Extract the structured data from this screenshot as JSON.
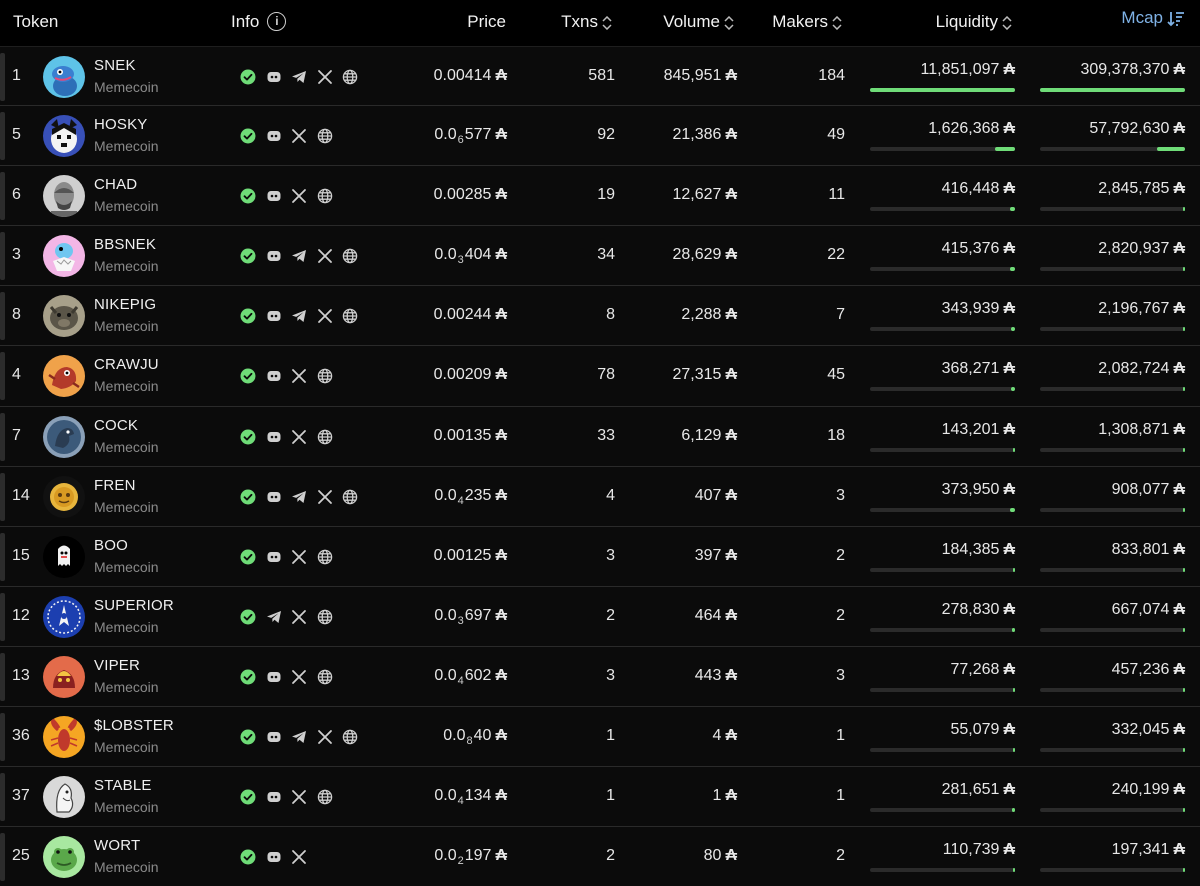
{
  "header": {
    "token": "Token",
    "info": "Info",
    "info_symbol": "i",
    "price": "Price",
    "txns": "Txns",
    "volume": "Volume",
    "makers": "Makers",
    "liquidity": "Liquidity",
    "mcap": "Mcap"
  },
  "colors": {
    "accent_green": "#6fdc78",
    "mcap_header": "#7fb2e6",
    "bar_track": "#2b2b2b"
  },
  "currency_symbol": "₳",
  "rows": [
    {
      "rank": "1",
      "name": "SNEK",
      "category": "Memecoin",
      "icons": [
        "verified-icon",
        "discord-icon",
        "telegram-icon",
        "x-icon",
        "globe-icon"
      ],
      "price_pre": "0.00414",
      "price_sub": "",
      "price_post": "",
      "txns": "581",
      "volume": "845,951",
      "makers": "184",
      "liquidity": "11,851,097",
      "liq_fill": 1.0,
      "mcap": "309,378,370",
      "mcap_fill": 1.0,
      "avatar": "snek"
    },
    {
      "rank": "5",
      "name": "HOSKY",
      "category": "Memecoin",
      "icons": [
        "verified-icon",
        "discord-icon",
        "x-icon",
        "globe-icon"
      ],
      "price_pre": "0.0",
      "price_sub": "6",
      "price_post": "577",
      "txns": "92",
      "volume": "21,386",
      "makers": "49",
      "liquidity": "1,626,368",
      "liq_fill": 0.14,
      "mcap": "57,792,630",
      "mcap_fill": 0.19,
      "avatar": "hosky"
    },
    {
      "rank": "6",
      "name": "CHAD",
      "category": "Memecoin",
      "icons": [
        "verified-icon",
        "discord-icon",
        "x-icon",
        "globe-icon"
      ],
      "price_pre": "0.00285",
      "price_sub": "",
      "price_post": "",
      "txns": "19",
      "volume": "12,627",
      "makers": "11",
      "liquidity": "416,448",
      "liq_fill": 0.035,
      "mcap": "2,845,785",
      "mcap_fill": 0.012,
      "avatar": "chad"
    },
    {
      "rank": "3",
      "name": "BBSNEK",
      "category": "Memecoin",
      "icons": [
        "verified-icon",
        "discord-icon",
        "telegram-icon",
        "x-icon",
        "globe-icon"
      ],
      "price_pre": "0.0",
      "price_sub": "3",
      "price_post": "404",
      "txns": "34",
      "volume": "28,629",
      "makers": "22",
      "liquidity": "415,376",
      "liq_fill": 0.035,
      "mcap": "2,820,937",
      "mcap_fill": 0.012,
      "avatar": "bbsnek"
    },
    {
      "rank": "8",
      "name": "NIKEPIG",
      "category": "Memecoin",
      "icons": [
        "verified-icon",
        "discord-icon",
        "telegram-icon",
        "x-icon",
        "globe-icon"
      ],
      "price_pre": "0.00244",
      "price_sub": "",
      "price_post": "",
      "txns": "8",
      "volume": "2,288",
      "makers": "7",
      "liquidity": "343,939",
      "liq_fill": 0.029,
      "mcap": "2,196,767",
      "mcap_fill": 0.01,
      "avatar": "nikepig"
    },
    {
      "rank": "4",
      "name": "CRAWJU",
      "category": "Memecoin",
      "icons": [
        "verified-icon",
        "discord-icon",
        "x-icon",
        "globe-icon"
      ],
      "price_pre": "0.00209",
      "price_sub": "",
      "price_post": "",
      "txns": "78",
      "volume": "27,315",
      "makers": "45",
      "liquidity": "368,271",
      "liq_fill": 0.031,
      "mcap": "2,082,724",
      "mcap_fill": 0.009,
      "avatar": "crawju"
    },
    {
      "rank": "7",
      "name": "COCK",
      "category": "Memecoin",
      "icons": [
        "verified-icon",
        "discord-icon",
        "x-icon",
        "globe-icon"
      ],
      "price_pre": "0.00135",
      "price_sub": "",
      "price_post": "",
      "txns": "33",
      "volume": "6,129",
      "makers": "18",
      "liquidity": "143,201",
      "liq_fill": 0.012,
      "mcap": "1,308,871",
      "mcap_fill": 0.006,
      "avatar": "cock"
    },
    {
      "rank": "14",
      "name": "FREN",
      "category": "Memecoin",
      "icons": [
        "verified-icon",
        "discord-icon",
        "telegram-icon",
        "x-icon",
        "globe-icon"
      ],
      "price_pre": "0.0",
      "price_sub": "4",
      "price_post": "235",
      "txns": "4",
      "volume": "407",
      "makers": "3",
      "liquidity": "373,950",
      "liq_fill": 0.032,
      "mcap": "908,077",
      "mcap_fill": 0.004,
      "avatar": "fren"
    },
    {
      "rank": "15",
      "name": "BOO",
      "category": "Memecoin",
      "icons": [
        "verified-icon",
        "discord-icon",
        "x-icon",
        "globe-icon"
      ],
      "price_pre": "0.00125",
      "price_sub": "",
      "price_post": "",
      "txns": "3",
      "volume": "397",
      "makers": "2",
      "liquidity": "184,385",
      "liq_fill": 0.016,
      "mcap": "833,801",
      "mcap_fill": 0.004,
      "avatar": "boo"
    },
    {
      "rank": "12",
      "name": "SUPERIOR",
      "category": "Memecoin",
      "icons": [
        "verified-icon",
        "telegram-icon",
        "x-icon",
        "globe-icon"
      ],
      "price_pre": "0.0",
      "price_sub": "3",
      "price_post": "697",
      "txns": "2",
      "volume": "464",
      "makers": "2",
      "liquidity": "278,830",
      "liq_fill": 0.024,
      "mcap": "667,074",
      "mcap_fill": 0.003,
      "avatar": "superior"
    },
    {
      "rank": "13",
      "name": "VIPER",
      "category": "Memecoin",
      "icons": [
        "verified-icon",
        "discord-icon",
        "x-icon",
        "globe-icon"
      ],
      "price_pre": "0.0",
      "price_sub": "4",
      "price_post": "602",
      "txns": "3",
      "volume": "443",
      "makers": "3",
      "liquidity": "77,268",
      "liq_fill": 0.007,
      "mcap": "457,236",
      "mcap_fill": 0.002,
      "avatar": "viper"
    },
    {
      "rank": "36",
      "name": "$LOBSTER",
      "category": "Memecoin",
      "icons": [
        "verified-icon",
        "discord-icon",
        "telegram-icon",
        "x-icon",
        "globe-icon"
      ],
      "price_pre": "0.0",
      "price_sub": "8",
      "price_post": "40",
      "txns": "1",
      "volume": "4",
      "makers": "1",
      "liquidity": "55,079",
      "liq_fill": 0.005,
      "mcap": "332,045",
      "mcap_fill": 0.002,
      "avatar": "lobster"
    },
    {
      "rank": "37",
      "name": "STABLE",
      "category": "Memecoin",
      "icons": [
        "verified-icon",
        "discord-icon",
        "x-icon",
        "globe-icon"
      ],
      "price_pre": "0.0",
      "price_sub": "4",
      "price_post": "134",
      "txns": "1",
      "volume": "1",
      "makers": "1",
      "liquidity": "281,651",
      "liq_fill": 0.024,
      "mcap": "240,199",
      "mcap_fill": 0.001,
      "avatar": "stable"
    },
    {
      "rank": "25",
      "name": "WORT",
      "category": "Memecoin",
      "icons": [
        "verified-icon",
        "discord-icon",
        "x-icon"
      ],
      "price_pre": "0.0",
      "price_sub": "2",
      "price_post": "197",
      "txns": "2",
      "volume": "80",
      "makers": "2",
      "liquidity": "110,739",
      "liq_fill": 0.009,
      "mcap": "197,341",
      "mcap_fill": 0.001,
      "avatar": "wort"
    }
  ]
}
